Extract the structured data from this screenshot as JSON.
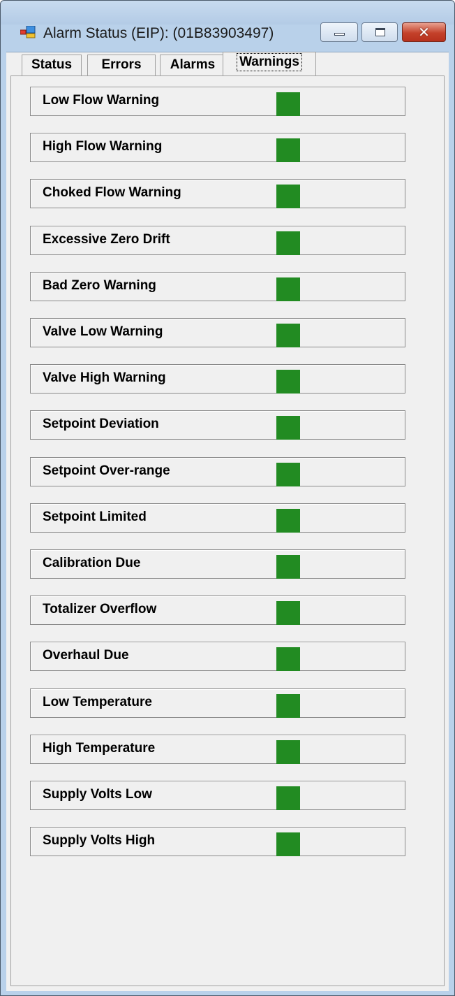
{
  "window": {
    "title": "Alarm Status (EIP): (01B83903497)",
    "icon": "app-window-icon",
    "buttons": {
      "minimize_icon": "minimize-icon",
      "maximize_icon": "maximize-icon",
      "close_icon": "close-icon",
      "close_glyph": "✕"
    }
  },
  "tabs": [
    {
      "label": "Status",
      "selected": false
    },
    {
      "label": "Errors",
      "selected": false
    },
    {
      "label": "Alarms",
      "selected": false
    },
    {
      "label": "Warnings",
      "selected": true
    }
  ],
  "indicator_color": "#228b22",
  "warnings": [
    {
      "label": "Low Flow Warning",
      "state": "ok"
    },
    {
      "label": "High Flow Warning",
      "state": "ok"
    },
    {
      "label": "Choked Flow Warning",
      "state": "ok"
    },
    {
      "label": "Excessive Zero Drift",
      "state": "ok"
    },
    {
      "label": "Bad Zero Warning",
      "state": "ok"
    },
    {
      "label": "Valve Low Warning",
      "state": "ok"
    },
    {
      "label": "Valve High Warning",
      "state": "ok"
    },
    {
      "label": "Setpoint Deviation",
      "state": "ok"
    },
    {
      "label": "Setpoint Over-range",
      "state": "ok"
    },
    {
      "label": "Setpoint Limited",
      "state": "ok"
    },
    {
      "label": "Calibration Due",
      "state": "ok"
    },
    {
      "label": "Totalizer Overflow",
      "state": "ok"
    },
    {
      "label": "Overhaul Due",
      "state": "ok"
    },
    {
      "label": "Low Temperature",
      "state": "ok"
    },
    {
      "label": "High Temperature",
      "state": "ok"
    },
    {
      "label": "Supply Volts Low",
      "state": "ok"
    },
    {
      "label": "Supply Volts High",
      "state": "ok"
    }
  ]
}
